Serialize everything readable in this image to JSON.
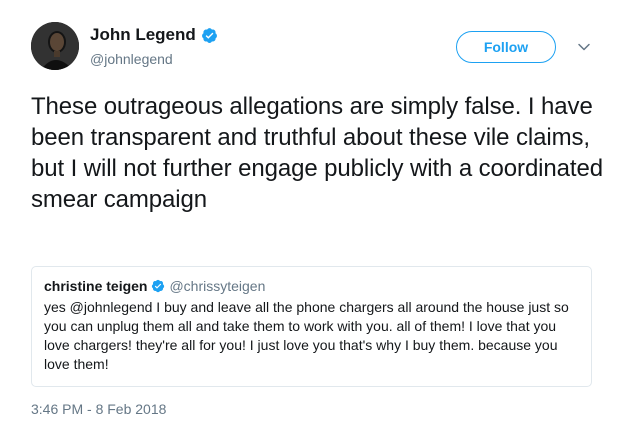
{
  "author": {
    "name": "John Legend",
    "handle": "@johnlegend",
    "verified": true
  },
  "follow_button": {
    "label": "Follow"
  },
  "tweet": {
    "text": "These outrageous allegations are simply false. I have been transparent and truthful about these vile claims, but I will not further engage publicly with a coordinated smear campaign",
    "timestamp": "3:46 PM - 8 Feb 2018"
  },
  "quoted_tweet": {
    "name": "christine teigen",
    "handle": "@chrissyteigen",
    "verified": true,
    "text": "yes @johnlegend I buy and leave all the phone chargers all around the house just so you can unplug them all and take them to work with you. all of them! I love that you love chargers! they're all for you! I just love you that's why I buy them. because you love them!"
  },
  "colors": {
    "accent": "#1da1f2",
    "secondary_text": "#657786",
    "border": "#e1e8ed"
  }
}
